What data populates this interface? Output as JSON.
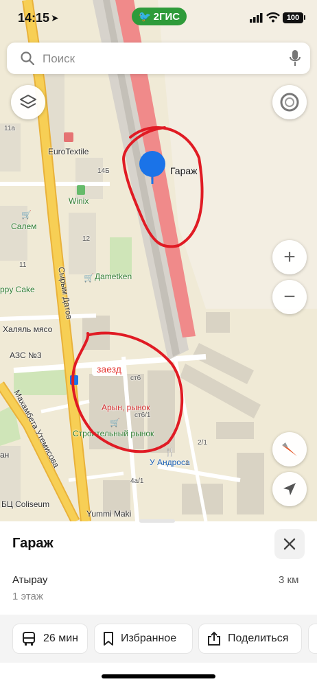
{
  "status_bar": {
    "time": "14:15",
    "battery": "100",
    "brand": "2ГИС"
  },
  "search": {
    "placeholder": "Поиск"
  },
  "map": {
    "pin_label": "Гараж",
    "entry_label": "заезд",
    "pois": {
      "eurotextile": "EuroTextile",
      "winix": "Winix",
      "salem": "Салем",
      "dametken": "Дametken",
      "happy_cake": "ppy Cake",
      "khalyal": "Халяль мясо",
      "azs": "АЗС №3",
      "arin_market": "Арын, рынок",
      "stroy_market": "Строительный рынок",
      "u_androsa": "У Андроса",
      "coliseum": "БЦ Coliseum",
      "yummi": "Yummi Maki"
    },
    "streets": {
      "datov": "Сырым Датов",
      "utemisova": "Махамбета Утемисова"
    },
    "house_numbers": {
      "n11a": "11а",
      "n14b": "14Б",
      "n12": "12",
      "n11": "11",
      "st6": "ст6",
      "st6_1": "ст6/1",
      "n2_1": "2/1",
      "n4a_1": "4а/1",
      "n1": "1",
      "kan": "ан"
    }
  },
  "place": {
    "title": "Гараж",
    "city": "Атырау",
    "floor": "1 этаж",
    "distance": "3 км"
  },
  "actions": {
    "transit_time": "26 мин",
    "favorites": "Избранное",
    "share": "Поделиться"
  },
  "colors": {
    "accent_green": "#2e9b3a",
    "pin_blue": "#1a73e8",
    "annotation_red": "#e01b24",
    "railway_red": "#f08080",
    "main_road": "#f6c84b"
  }
}
